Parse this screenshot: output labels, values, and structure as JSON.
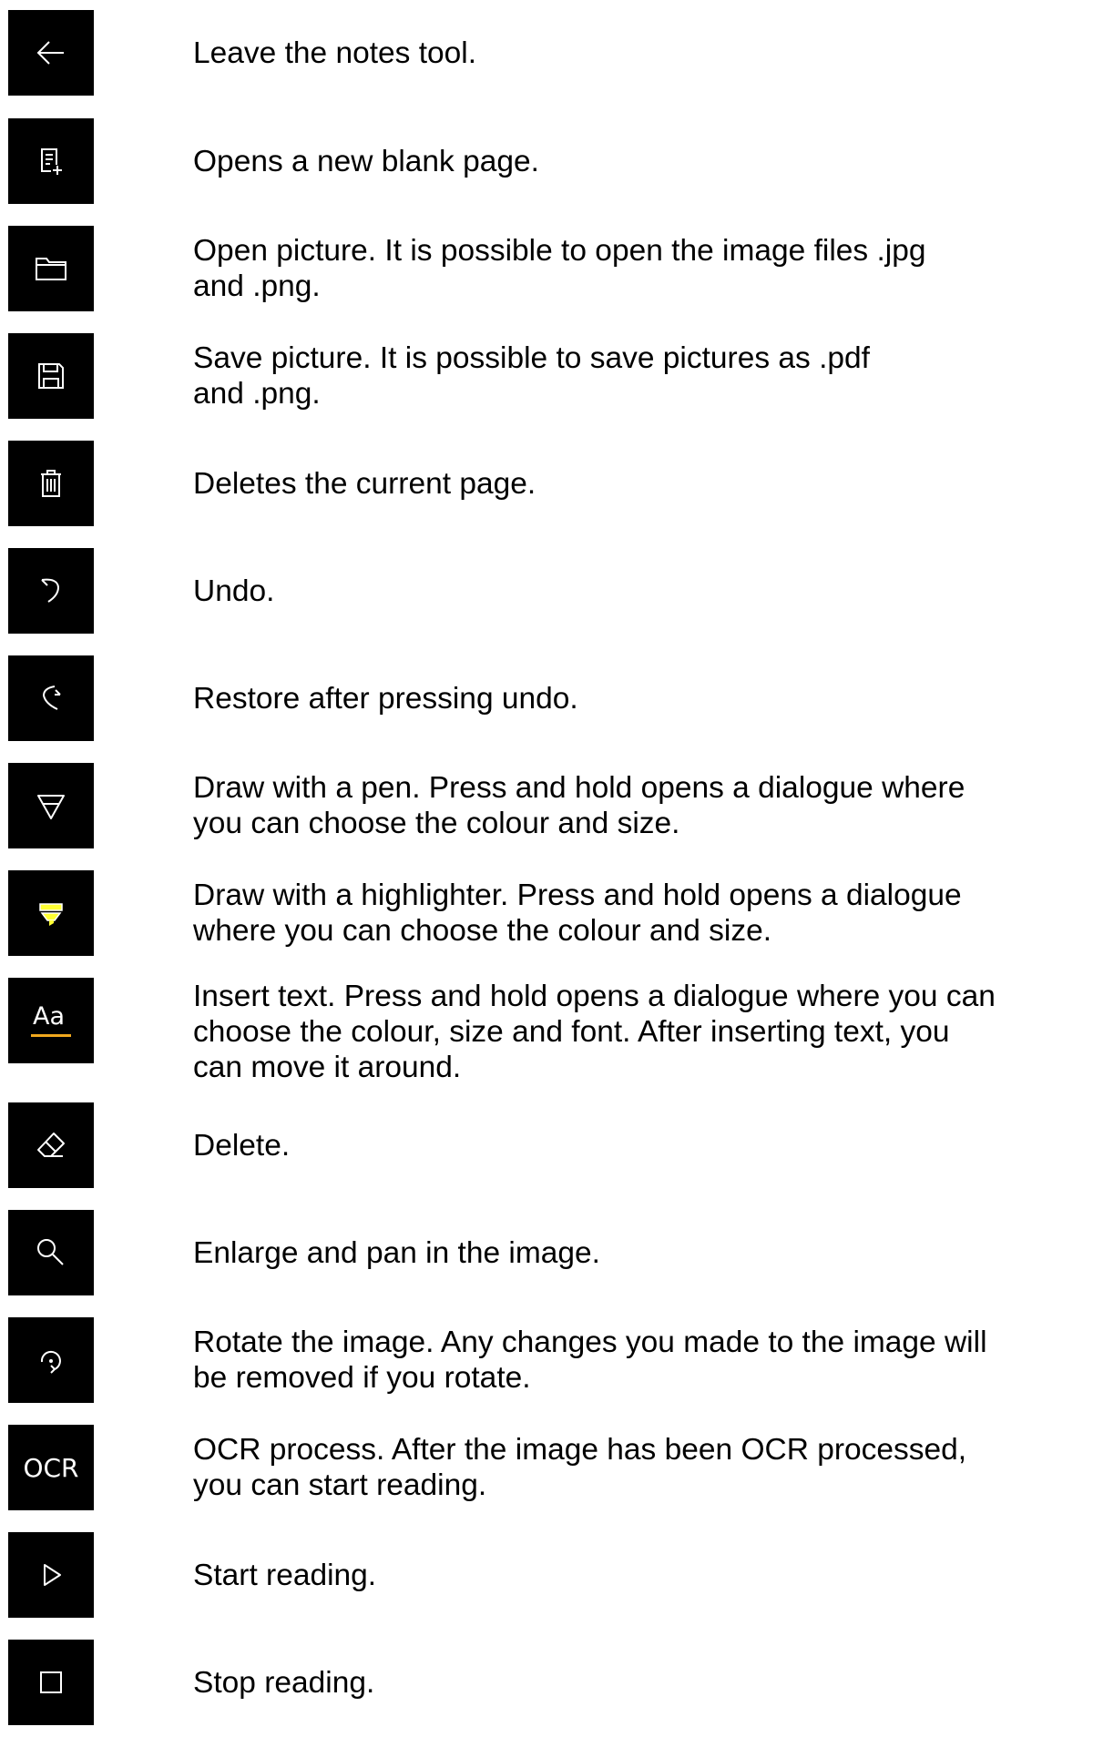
{
  "colors": {
    "icon_background": "#000000",
    "icon_glyph": "#ffffff",
    "highlight": "#ffff33",
    "text_underline": "#f0a81e"
  },
  "items": [
    {
      "icon": "back-arrow-icon",
      "text": "Leave the notes tool."
    },
    {
      "icon": "new-page-icon",
      "text": "Opens a new blank page."
    },
    {
      "icon": "folder-icon",
      "text": "Open picture. It is possible to open the image files .jpg\nand .png."
    },
    {
      "icon": "save-icon",
      "text": "Save picture. It is possible to save pictures as .pdf\nand .png."
    },
    {
      "icon": "trash-icon",
      "text": "Deletes the current page."
    },
    {
      "icon": "undo-icon",
      "text": "Undo."
    },
    {
      "icon": "redo-icon",
      "text": "Restore after pressing undo."
    },
    {
      "icon": "pen-icon",
      "text": "Draw with a pen. Press and hold opens a dialogue where\nyou can choose the colour and size."
    },
    {
      "icon": "highlighter-icon",
      "text": "Draw with a highlighter. Press and hold opens a dialogue\nwhere you can choose the colour and size."
    },
    {
      "icon": "text-icon",
      "icon_label": "Aa",
      "text": "Insert text. Press and hold opens a dialogue where you can\nchoose the colour, size and font. After inserting text, you\ncan move it around."
    },
    {
      "icon": "eraser-icon",
      "text": "Delete."
    },
    {
      "icon": "zoom-icon",
      "text": "Enlarge and pan in the image."
    },
    {
      "icon": "rotate-icon",
      "text": "Rotate the image. Any changes you made to the image will\nbe removed if you rotate."
    },
    {
      "icon": "ocr-icon",
      "icon_label": "OCR",
      "text": "OCR process. After the image has been OCR processed,\nyou can start reading."
    },
    {
      "icon": "play-icon",
      "text": "Start reading."
    },
    {
      "icon": "stop-icon",
      "text": "Stop reading."
    }
  ]
}
